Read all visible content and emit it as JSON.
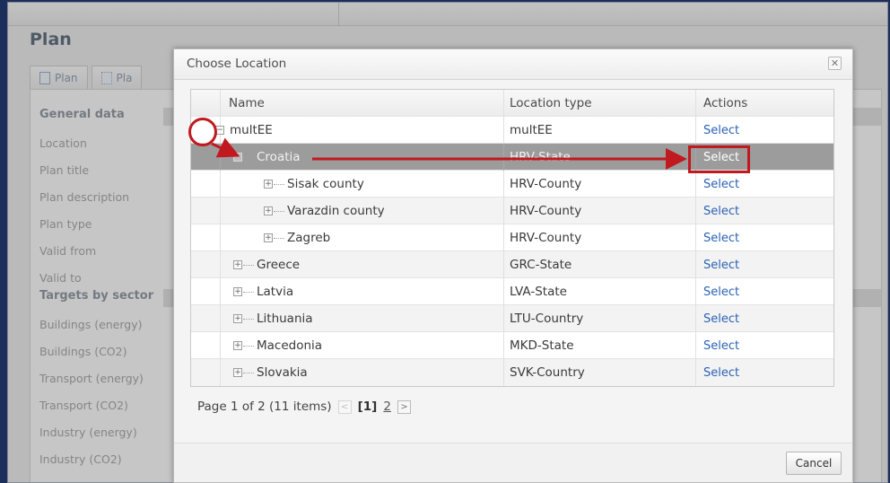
{
  "background": {
    "title": "Plan",
    "tabs": [
      "Plan",
      "Pla"
    ],
    "general_heading": "General data",
    "general_fields": [
      "Location",
      "Plan title",
      "Plan description",
      "Plan type",
      "Valid from",
      "Valid to"
    ],
    "targets_heading": "Targets by sector",
    "target_fields": [
      "Buildings (energy)",
      "Buildings (CO2)",
      "Transport (energy)",
      "Transport (CO2)",
      "Industry (energy)",
      "Industry (CO2)"
    ]
  },
  "dialog": {
    "title": "Choose Location",
    "close_icon": "close-icon",
    "columns": {
      "name": "Name",
      "type": "Location type",
      "actions": "Actions"
    },
    "rows": [
      {
        "name": "multEE",
        "type": "multEE",
        "action": "Select",
        "level": 0,
        "expander": "⊖"
      },
      {
        "name": "Croatia",
        "type": "HRV-State",
        "action": "Select",
        "level": 1,
        "expander": "⊖",
        "selected": true
      },
      {
        "name": "Sisak county",
        "type": "HRV-County",
        "action": "Select",
        "level": 2,
        "expander": "⊕"
      },
      {
        "name": "Varazdin county",
        "type": "HRV-County",
        "action": "Select",
        "level": 2,
        "expander": "⊕"
      },
      {
        "name": "Zagreb",
        "type": "HRV-County",
        "action": "Select",
        "level": 2,
        "expander": "⊕"
      },
      {
        "name": "Greece",
        "type": "GRC-State",
        "action": "Select",
        "level": 1,
        "expander": "⊕"
      },
      {
        "name": "Latvia",
        "type": "LVA-State",
        "action": "Select",
        "level": 1,
        "expander": "⊕"
      },
      {
        "name": "Lithuania",
        "type": "LTU-Country",
        "action": "Select",
        "level": 1,
        "expander": "⊕"
      },
      {
        "name": "Macedonia",
        "type": "MKD-State",
        "action": "Select",
        "level": 1,
        "expander": "⊕"
      },
      {
        "name": "Slovakia",
        "type": "SVK-Country",
        "action": "Select",
        "level": 1,
        "expander": "⊕"
      }
    ],
    "pager": {
      "summary": "Page 1 of 2 (11 items)",
      "prev": "<",
      "current": "[1]",
      "page2": "2",
      "next": ">"
    },
    "cancel_label": "Cancel"
  },
  "colors": {
    "annotation": "#c0191f",
    "link": "#2a62b4",
    "selected_row": "#9c9c9c"
  }
}
